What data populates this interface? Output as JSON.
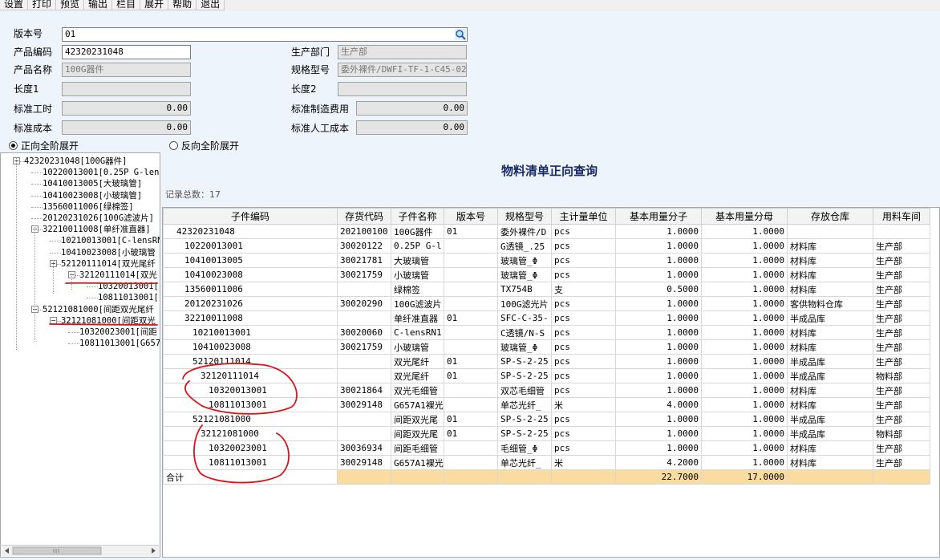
{
  "menu": [
    "设置",
    "打印",
    "预览",
    "输出",
    "栏目",
    "展开",
    "帮助",
    "退出"
  ],
  "form": {
    "version_label": "版本号",
    "version_value": "01",
    "code_label": "产品编码",
    "code_value": "42320231048",
    "name_label": "产品名称",
    "name_value": "100G器件",
    "length1_label": "长度1",
    "length1_value": "",
    "std_hours_label": "标准工时",
    "std_hours_value": "0.00",
    "std_cost_label": "标准成本",
    "std_cost_value": "0.00",
    "dept_label": "生产部门",
    "dept_value": "生产部",
    "spec_label": "规格型号",
    "spec_value": "委外裸件/DWFI-TF-1-C45-025T",
    "length2_label": "长度2",
    "length2_value": "",
    "mfg_cost_label": "标准制造费用",
    "mfg_cost_value": "0.00",
    "labor_cost_label": "标准人工成本",
    "labor_cost_value": "0.00"
  },
  "radios": {
    "forward": "正向全阶展开",
    "reverse": "反向全阶展开"
  },
  "tree": [
    {
      "text": "42320231048[100G器件]",
      "level": 0,
      "toggle": "-"
    },
    {
      "text": "10220013001[0.25P G-lens",
      "level": 1,
      "toggle": ""
    },
    {
      "text": "10410013005[大玻璃管]",
      "level": 1,
      "toggle": ""
    },
    {
      "text": "10410023008[小玻璃管]",
      "level": 1,
      "toggle": ""
    },
    {
      "text": "13560011006[绿棉签]",
      "level": 1,
      "toggle": ""
    },
    {
      "text": "20120231026[100G滤波片]",
      "level": 1,
      "toggle": ""
    },
    {
      "text": "32210011008[单纤准直器]",
      "level": 1,
      "toggle": "-"
    },
    {
      "text": "10210013001[C-lensRN",
      "level": 2,
      "toggle": ""
    },
    {
      "text": "10410023008[小玻璃管",
      "level": 2,
      "toggle": ""
    },
    {
      "text": "52120111014[双光尾纤",
      "level": 2,
      "toggle": "-"
    },
    {
      "text": "32120111014[双光",
      "level": 3,
      "toggle": "-"
    },
    {
      "text": "10320013001[",
      "level": 4,
      "toggle": ""
    },
    {
      "text": "10811013001[",
      "level": 4,
      "toggle": ""
    },
    {
      "text": "52121081000[间距双光尾纤",
      "level": 1,
      "toggle": "-"
    },
    {
      "text": "32121081000[间距双光",
      "level": 2,
      "toggle": "-"
    },
    {
      "text": "10320023001[间距",
      "level": 3,
      "toggle": ""
    },
    {
      "text": "10811013001[G657",
      "level": 3,
      "toggle": ""
    }
  ],
  "title": "物料清单正向查询",
  "record_count": "记录总数：17",
  "columns": [
    "子件编码",
    "存货代码",
    "子件名称",
    "版本号",
    "规格型号",
    "主计量单位",
    "基本用量分子",
    "基本用量分母",
    "存放仓库",
    "用料车间"
  ],
  "rows": [
    {
      "code": "42320231048",
      "inv": "202100100",
      "name": "100G器件",
      "ver": "01",
      "spec": "委外裸件/D",
      "unit": "pcs",
      "num": "1.0000",
      "den": "1.0000",
      "wh": "",
      "ws": "",
      "indent": 0
    },
    {
      "code": "10220013001",
      "inv": "30020122",
      "name": "0.25P G-l",
      "ver": "",
      "spec": "G透镜_.25",
      "unit": "pcs",
      "num": "1.0000",
      "den": "1.0000",
      "wh": "材料库",
      "ws": "生产部",
      "indent": 1
    },
    {
      "code": "10410013005",
      "inv": "30021781",
      "name": "大玻璃管",
      "ver": "",
      "spec": "玻璃管_Φ",
      "unit": "pcs",
      "num": "1.0000",
      "den": "1.0000",
      "wh": "材料库",
      "ws": "生产部",
      "indent": 1
    },
    {
      "code": "10410023008",
      "inv": "30021759",
      "name": "小玻璃管",
      "ver": "",
      "spec": "玻璃管_Φ",
      "unit": "pcs",
      "num": "1.0000",
      "den": "1.0000",
      "wh": "材料库",
      "ws": "生产部",
      "indent": 1
    },
    {
      "code": "13560011006",
      "inv": "",
      "name": "绿棉签",
      "ver": "",
      "spec": "TX754B",
      "unit": "支",
      "num": "0.5000",
      "den": "1.0000",
      "wh": "材料库",
      "ws": "生产部",
      "indent": 1
    },
    {
      "code": "20120231026",
      "inv": "30020290",
      "name": "100G滤波片",
      "ver": "",
      "spec": "100G滤光片",
      "unit": "pcs",
      "num": "1.0000",
      "den": "1.0000",
      "wh": "客供物料仓库",
      "ws": "生产部",
      "indent": 1
    },
    {
      "code": "32210011008",
      "inv": "",
      "name": "单纤准直器",
      "ver": "01",
      "spec": "SFC-C-35-",
      "unit": "pcs",
      "num": "1.0000",
      "den": "1.0000",
      "wh": "半成品库",
      "ws": "生产部",
      "indent": 1
    },
    {
      "code": "10210013001",
      "inv": "30020060",
      "name": "C-lensRN1",
      "ver": "",
      "spec": "C透镜/N-S",
      "unit": "pcs",
      "num": "1.0000",
      "den": "1.0000",
      "wh": "材料库",
      "ws": "生产部",
      "indent": 2
    },
    {
      "code": "10410023008",
      "inv": "30021759",
      "name": "小玻璃管",
      "ver": "",
      "spec": "玻璃管_Φ",
      "unit": "pcs",
      "num": "1.0000",
      "den": "1.0000",
      "wh": "材料库",
      "ws": "生产部",
      "indent": 2
    },
    {
      "code": "52120111014",
      "inv": "",
      "name": "双光尾纤",
      "ver": "01",
      "spec": "SP-S-2-25",
      "unit": "pcs",
      "num": "1.0000",
      "den": "1.0000",
      "wh": "半成品库",
      "ws": "生产部",
      "indent": 2
    },
    {
      "code": "32120111014",
      "inv": "",
      "name": "双光尾纤",
      "ver": "01",
      "spec": "SP-S-2-25",
      "unit": "pcs",
      "num": "1.0000",
      "den": "1.0000",
      "wh": "半成品库",
      "ws": "物料部",
      "indent": 3
    },
    {
      "code": "10320013001",
      "inv": "30021864",
      "name": "双光毛细管",
      "ver": "",
      "spec": "双芯毛细管",
      "unit": "pcs",
      "num": "1.0000",
      "den": "1.0000",
      "wh": "材料库",
      "ws": "生产部",
      "indent": 4
    },
    {
      "code": "10811013001",
      "inv": "30029148",
      "name": "G657A1裸光",
      "ver": "",
      "spec": "单芯光纤_",
      "unit": "米",
      "num": "4.0000",
      "den": "1.0000",
      "wh": "材料库",
      "ws": "生产部",
      "indent": 4
    },
    {
      "code": "52121081000",
      "inv": "",
      "name": "间距双光尾",
      "ver": "01",
      "spec": "SP-S-2-25",
      "unit": "pcs",
      "num": "1.0000",
      "den": "1.0000",
      "wh": "半成品库",
      "ws": "生产部",
      "indent": 2
    },
    {
      "code": "32121081000",
      "inv": "",
      "name": "间距双光尾",
      "ver": "01",
      "spec": "SP-S-2-25",
      "unit": "pcs",
      "num": "1.0000",
      "den": "1.0000",
      "wh": "半成品库",
      "ws": "物料部",
      "indent": 3
    },
    {
      "code": "10320023001",
      "inv": "30036934",
      "name": "间距毛细管",
      "ver": "",
      "spec": "毛细管_Φ",
      "unit": "pcs",
      "num": "1.0000",
      "den": "1.0000",
      "wh": "材料库",
      "ws": "生产部",
      "indent": 4
    },
    {
      "code": "10811013001",
      "inv": "30029148",
      "name": "G657A1裸光",
      "ver": "",
      "spec": "单芯光纤_",
      "unit": "米",
      "num": "4.2000",
      "den": "1.0000",
      "wh": "材料库",
      "ws": "生产部",
      "indent": 4
    }
  ],
  "total": {
    "label": "合计",
    "num": "22.7000",
    "den": "17.0000"
  }
}
